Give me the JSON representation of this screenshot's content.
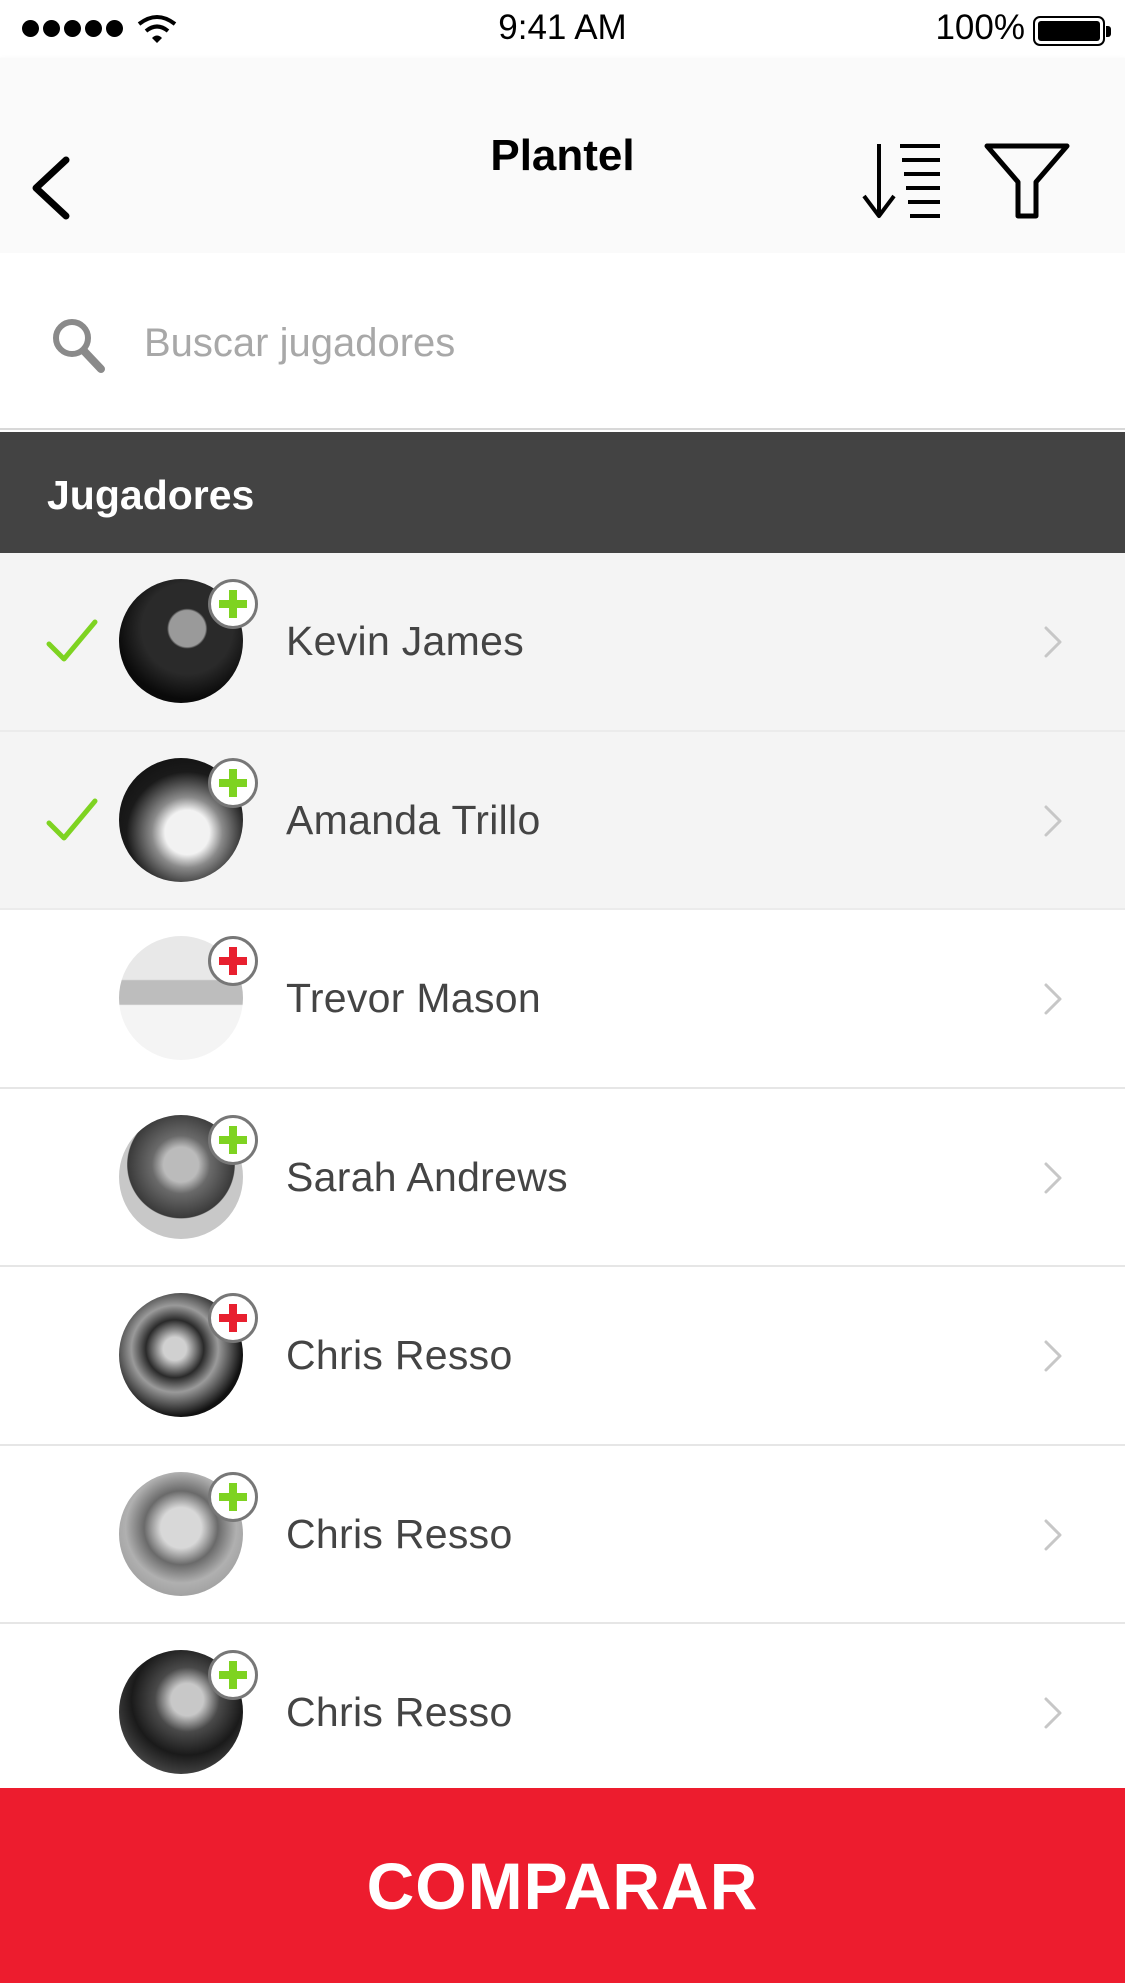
{
  "status_bar": {
    "time": "9:41 AM",
    "battery": "100%"
  },
  "nav": {
    "title": "Plantel",
    "back_icon": "chevron-left-icon",
    "sort_icon": "sort-descending-icon",
    "filter_icon": "filter-funnel-icon"
  },
  "search": {
    "placeholder": "Buscar jugadores",
    "value": ""
  },
  "section": {
    "title": "Jugadores"
  },
  "players": [
    {
      "name": "Kevin James",
      "selected": true,
      "badge": "plus",
      "badge_color": "#7ed321"
    },
    {
      "name": "Amanda Trillo",
      "selected": true,
      "badge": "plus",
      "badge_color": "#7ed321"
    },
    {
      "name": "Trevor Mason",
      "selected": false,
      "badge": "plus",
      "badge_color": "#e8202f"
    },
    {
      "name": "Sarah Andrews",
      "selected": false,
      "badge": "plus",
      "badge_color": "#7ed321"
    },
    {
      "name": "Chris Resso",
      "selected": false,
      "badge": "plus",
      "badge_color": "#e8202f"
    },
    {
      "name": "Chris Resso",
      "selected": false,
      "badge": "plus",
      "badge_color": "#7ed321"
    },
    {
      "name": "Chris Resso",
      "selected": false,
      "badge": "plus",
      "badge_color": "#7ed321"
    }
  ],
  "colors": {
    "accent": "#ed1c2e",
    "check": "#7ed321",
    "section_bg": "#434343"
  },
  "compare_button": {
    "label": "COMPARAR"
  }
}
